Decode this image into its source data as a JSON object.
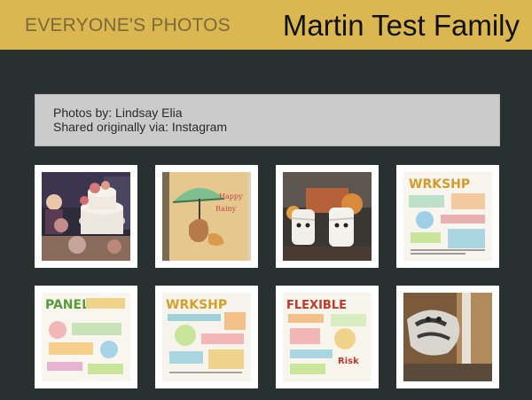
{
  "header": {
    "section_title": "EVERYONE'S PHOTOS",
    "family_name": "Martin Test Family"
  },
  "info": {
    "photographer_line": "Photos by: Lindsay Elia",
    "source_line": "Shared originally via: Instagram"
  },
  "photos": [
    {
      "subject": "cake-party"
    },
    {
      "subject": "umbrella-cookie"
    },
    {
      "subject": "marshmallow-mummies"
    },
    {
      "subject": "workshop-sketchnote"
    },
    {
      "subject": "panel-sketchnote"
    },
    {
      "subject": "workshop-sketchnote"
    },
    {
      "subject": "flexible-cut-sketchnote"
    },
    {
      "subject": "cat"
    }
  ],
  "colors": {
    "header_bg": "#dab750",
    "page_bg": "#283030",
    "info_bg": "#cbcbcb"
  }
}
